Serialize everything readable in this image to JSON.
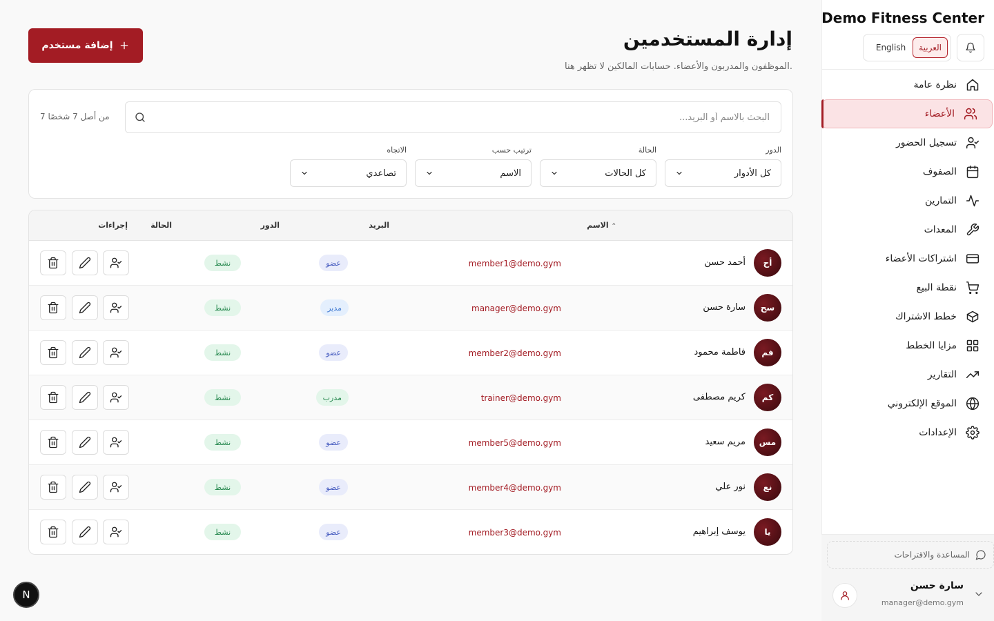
{
  "sidebar": {
    "brand": "Demo Fitness Center",
    "lang": {
      "arabic": "العربية",
      "english": "English",
      "active": "arabic"
    },
    "items": [
      {
        "label": "نظرة عامة",
        "icon": "home-icon",
        "active": false
      },
      {
        "label": "الأعضاء",
        "icon": "users-icon",
        "active": true
      },
      {
        "label": "تسجيل الحضور",
        "icon": "user-check-icon",
        "active": false
      },
      {
        "label": "الصفوف",
        "icon": "calendar-icon",
        "active": false
      },
      {
        "label": "التمارين",
        "icon": "activity-icon",
        "active": false
      },
      {
        "label": "المعدات",
        "icon": "wrench-icon",
        "active": false
      },
      {
        "label": "اشتراكات الأعضاء",
        "icon": "credit-card-icon",
        "active": false
      },
      {
        "label": "نقطة البيع",
        "icon": "cart-icon",
        "active": false
      },
      {
        "label": "خطط الاشتراك",
        "icon": "box-icon",
        "active": false
      },
      {
        "label": "مزايا الخطط",
        "icon": "grid-icon",
        "active": false
      },
      {
        "label": "التقارير",
        "icon": "trending-up-icon",
        "active": false
      },
      {
        "label": "الموقع الإلكتروني",
        "icon": "globe-icon",
        "active": false
      },
      {
        "label": "الإعدادات",
        "icon": "gear-icon",
        "active": false
      }
    ],
    "help_label": "المساعدة والاقتراحات",
    "user": {
      "name": "سارة حسن",
      "email": "manager@demo.gym"
    }
  },
  "header": {
    "title": "إدارة المستخدمين",
    "subtitle": "الموظفون والمدربون والأعضاء. حسابات المالكين لا تظهر هنا.",
    "add_button": "إضافة مستخدم"
  },
  "filters": {
    "search_placeholder": "البحث بالاسم أو البريد...",
    "count_text": "7 من أصل 7 شخصًا",
    "role": {
      "label": "الدور",
      "value": "كل الأدوار"
    },
    "status": {
      "label": "الحالة",
      "value": "كل الحالات"
    },
    "sort_by": {
      "label": "ترتيب حسب",
      "value": "الاسم"
    },
    "direction": {
      "label": "الاتجاه",
      "value": "تصاعدي"
    }
  },
  "table": {
    "columns": {
      "name": "الاسم",
      "email": "البريد",
      "role": "الدور",
      "status": "الحالة",
      "actions": "إجراءات"
    },
    "rows": [
      {
        "initials": "أح",
        "name": "أحمد حسن",
        "email": "member1@demo.gym",
        "role": "عضو",
        "role_type": "member",
        "status": "نشط"
      },
      {
        "initials": "سح",
        "name": "سارة حسن",
        "email": "manager@demo.gym",
        "role": "مدير",
        "role_type": "manager",
        "status": "نشط"
      },
      {
        "initials": "فم",
        "name": "فاطمة محمود",
        "email": "member2@demo.gym",
        "role": "عضو",
        "role_type": "member",
        "status": "نشط"
      },
      {
        "initials": "كم",
        "name": "كريم مصطفى",
        "email": "trainer@demo.gym",
        "role": "مدرب",
        "role_type": "trainer",
        "status": "نشط"
      },
      {
        "initials": "مس",
        "name": "مريم سعيد",
        "email": "member5@demo.gym",
        "role": "عضو",
        "role_type": "member",
        "status": "نشط"
      },
      {
        "initials": "نع",
        "name": "نور علي",
        "email": "member4@demo.gym",
        "role": "عضو",
        "role_type": "member",
        "status": "نشط"
      },
      {
        "initials": "يا",
        "name": "يوسف إبراهيم",
        "email": "member3@demo.gym",
        "role": "عضو",
        "role_type": "member",
        "status": "نشط"
      }
    ]
  },
  "colors": {
    "accent": "#a31c24",
    "active_bg": "#fbe3e5",
    "status_green": "#2a8a51"
  },
  "dev_badge": "N"
}
